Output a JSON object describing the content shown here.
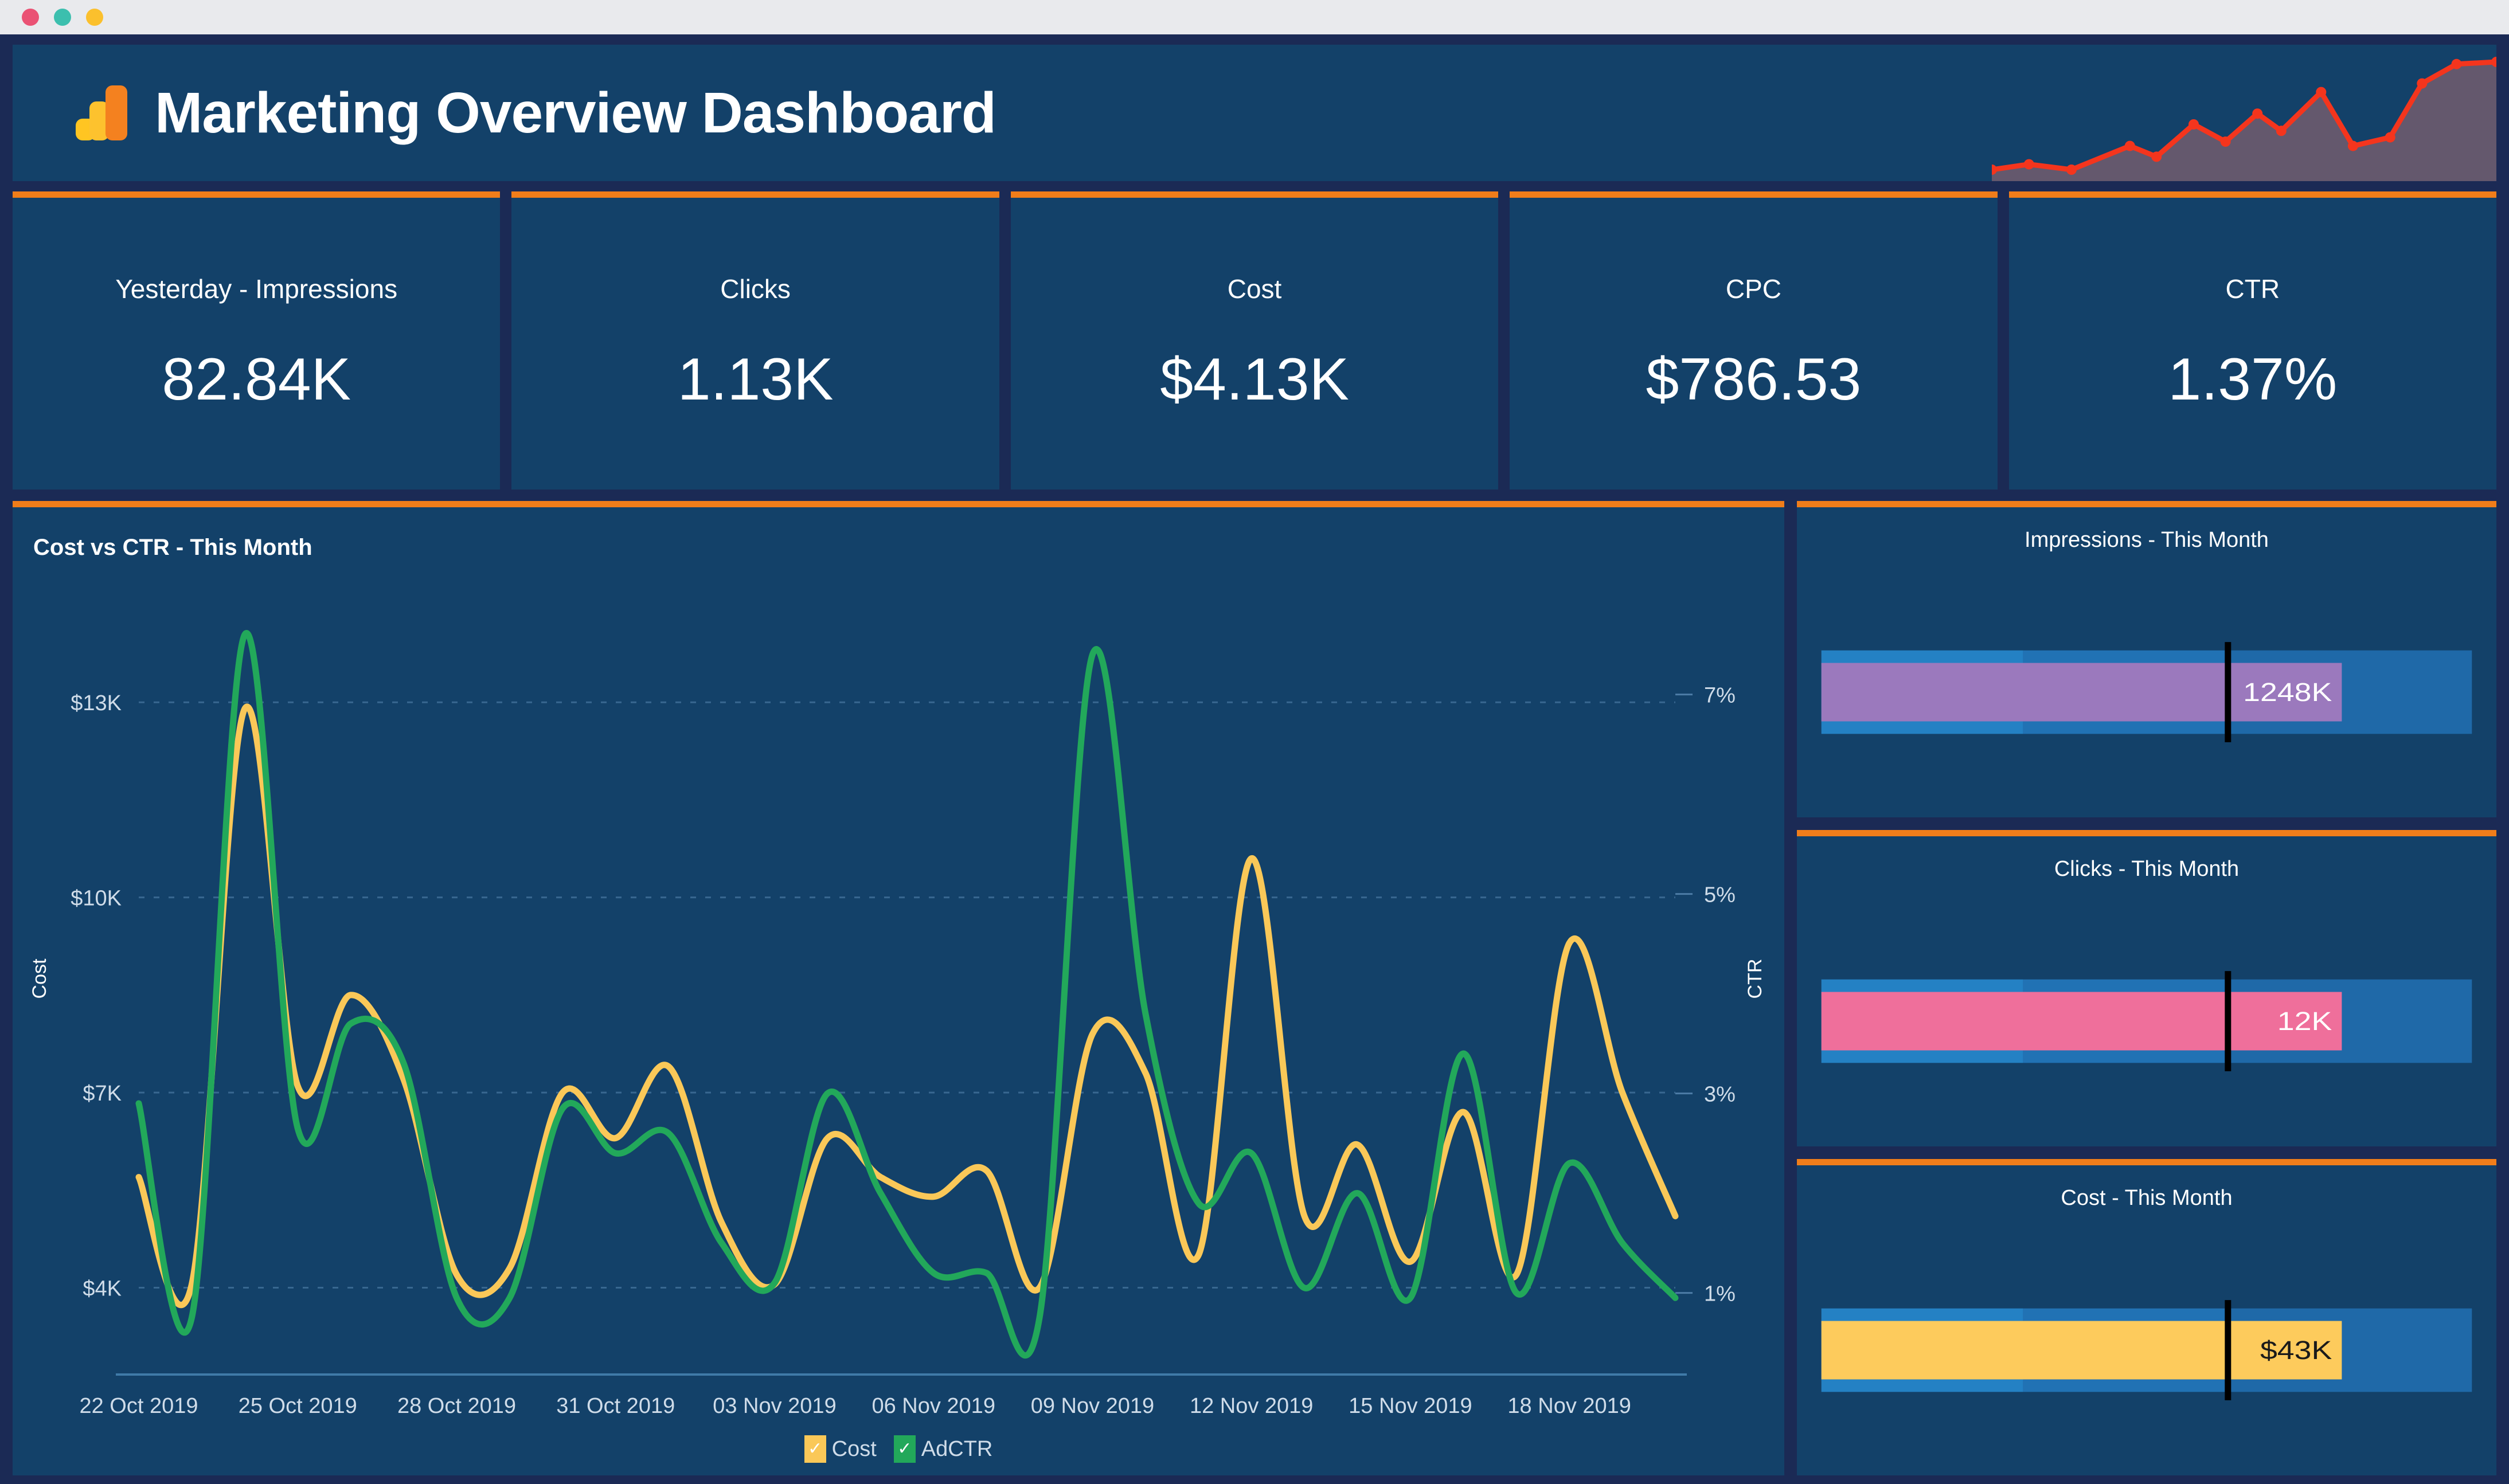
{
  "window": {
    "dots": [
      "close-dot",
      "minimize-dot",
      "maximize-dot"
    ],
    "dot_colors": [
      "#ea5274",
      "#3cbfae",
      "#fbc02d"
    ],
    "chrome_bg": "#e9eaed"
  },
  "theme": {
    "page_bg": "#1b2a55",
    "card_bg": "#134169",
    "accent_orange": "#f07d1a",
    "cost_yellow": "#fac858",
    "ctr_green": "#22a85a",
    "spark_red": "#f4351d",
    "impressions_purple": "#9b79bd",
    "clicks_pink": "#ef6f9b",
    "bullet_band_light": "#2481c4",
    "bullet_band_mid": "#2172b4",
    "bullet_band_dark": "#1f69a8",
    "target_black": "#000000"
  },
  "header": {
    "title": "Marketing Overview Dashboard",
    "logo_icon": "google-analytics-icon",
    "sparkline_icon": "trend-sparkline"
  },
  "kpis": [
    {
      "label": "Yesterday - Impressions",
      "value": "82.84K"
    },
    {
      "label": "Clicks",
      "value": "1.13K"
    },
    {
      "label": "Cost",
      "value": "$4.13K"
    },
    {
      "label": "CPC",
      "value": "$786.53"
    },
    {
      "label": "CTR",
      "value": "1.37%"
    }
  ],
  "line_chart": {
    "title": "Cost vs CTR - This Month",
    "legend": [
      {
        "label": "Cost",
        "color": "#fac858",
        "checked": true,
        "check_glyph": "✓"
      },
      {
        "label": "AdCTR",
        "color": "#22a85a",
        "checked": true,
        "check_glyph": "✓"
      }
    ]
  },
  "bullets": [
    {
      "title": "Impressions - This Month",
      "value_label": "1248K",
      "bar_color": "#9b79bd",
      "label_color": "#ffffff",
      "bar_pct": 80,
      "target_pct": 62.5,
      "bands": [
        31,
        62,
        100
      ]
    },
    {
      "title": "Clicks - This Month",
      "value_label": "12K",
      "bar_color": "#ef6f9b",
      "label_color": "#ffffff",
      "bar_pct": 80,
      "target_pct": 62.5,
      "bands": [
        31,
        62,
        100
      ]
    },
    {
      "title": "Cost - This Month",
      "value_label": "$43K",
      "bar_color": "#fdcb5c",
      "label_color": "#1a1a1a",
      "bar_pct": 80,
      "target_pct": 62.5,
      "bands": [
        31,
        62,
        100
      ]
    }
  ],
  "chart_data": {
    "type": "line",
    "title": "Cost vs CTR - This Month",
    "xlabel": "",
    "ylabel": "Cost",
    "y2label": "CTR",
    "grid": true,
    "legend_position": "bottom",
    "axis_left": {
      "ticks": [
        "$4K",
        "$7K",
        "$10K",
        "$13K"
      ],
      "tick_values": [
        4000,
        7000,
        10000,
        13000
      ],
      "ylim": [
        3000,
        14500
      ]
    },
    "axis_right": {
      "ticks": [
        "1%",
        "3%",
        "5%",
        "7%"
      ],
      "tick_values": [
        1,
        3,
        5,
        7
      ],
      "ylim": [
        0.4,
        7.9
      ]
    },
    "x_tick_labels": [
      "22 Oct 2019",
      "25 Oct 2019",
      "28 Oct 2019",
      "31 Oct 2019",
      "03 Nov 2019",
      "06 Nov 2019",
      "09 Nov 2019",
      "12 Nov 2019",
      "15 Nov 2019",
      "18 Nov 2019"
    ],
    "x": [
      "22 Oct 2019",
      "23 Oct 2019",
      "24 Oct 2019",
      "25 Oct 2019",
      "26 Oct 2019",
      "27 Oct 2019",
      "28 Oct 2019",
      "29 Oct 2019",
      "30 Oct 2019",
      "31 Oct 2019",
      "01 Nov 2019",
      "02 Nov 2019",
      "03 Nov 2019",
      "04 Nov 2019",
      "05 Nov 2019",
      "06 Nov 2019",
      "07 Nov 2019",
      "08 Nov 2019",
      "09 Nov 2019",
      "10 Nov 2019",
      "11 Nov 2019",
      "12 Nov 2019",
      "13 Nov 2019",
      "14 Nov 2019",
      "15 Nov 2019",
      "16 Nov 2019",
      "17 Nov 2019",
      "18 Nov 2019",
      "19 Nov 2019",
      "20 Nov 2019"
    ],
    "series": [
      {
        "name": "Cost",
        "axis": "left",
        "color": "#fac858",
        "values": [
          5700,
          4050,
          12900,
          7100,
          8500,
          7200,
          4200,
          4300,
          7000,
          6300,
          7400,
          5000,
          4050,
          6300,
          5700,
          5400,
          5800,
          4000,
          7900,
          7300,
          4500,
          10600,
          5100,
          6200,
          4400,
          6700,
          4200,
          9300,
          7000,
          5100
        ]
      },
      {
        "name": "AdCTR",
        "axis": "right",
        "color": "#22a85a",
        "values": [
          2.9,
          0.75,
          7.6,
          2.65,
          3.7,
          3.3,
          0.95,
          0.95,
          2.85,
          2.4,
          2.6,
          1.5,
          1.1,
          3.0,
          2.0,
          1.2,
          1.2,
          0.75,
          7.4,
          3.8,
          1.9,
          2.4,
          1.05,
          2.0,
          0.95,
          3.4,
          1.0,
          2.3,
          1.5,
          0.95
        ]
      }
    ]
  },
  "sparkline": {
    "color": "#f4351d",
    "fill": "#6b5a6e",
    "points": [
      0,
      0,
      14,
      5,
      30,
      0,
      52,
      22,
      62,
      12,
      76,
      42,
      88,
      26,
      100,
      52,
      109,
      36,
      124,
      72,
      136,
      22,
      150,
      30,
      162,
      80,
      175,
      98,
      190,
      100
    ]
  }
}
